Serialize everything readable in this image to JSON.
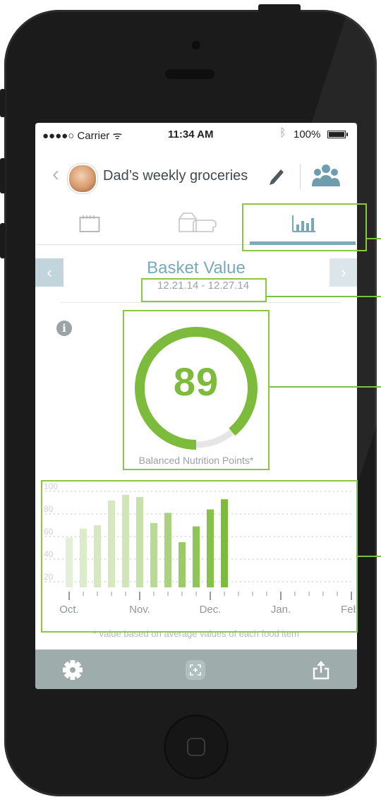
{
  "status_bar": {
    "carrier": "●●●●○ Carrier ᯤ",
    "time": "11:34 AM",
    "battery": "100%"
  },
  "nav": {
    "title": "Dad’s weekly groceries"
  },
  "summary": {
    "title": "Basket Value",
    "date_range": "12.21.14 - 12.27.14",
    "score": "89",
    "score_fraction": 0.89,
    "caption": "Balanced Nutrition Points*"
  },
  "footnote": "* value based on average values of each food item",
  "colors": {
    "accent_green": "#7dbb3c",
    "annotation_green": "#8dc63f",
    "title_blue": "#78a9bb",
    "toolbar": "#9eacac"
  },
  "icons": {
    "settings": "gear-icon",
    "scan": "scan-icon",
    "share": "share-icon",
    "edit": "pencil-icon",
    "group": "group-icon",
    "info": "info-icon"
  },
  "chart_data": {
    "type": "bar",
    "ylim": [
      15,
      105
    ],
    "y_ticks": [
      "100",
      "80",
      "60",
      "40",
      "20"
    ],
    "y_tick_values": [
      100,
      80,
      60,
      40,
      20
    ],
    "x_labels": [
      "Oct.",
      "Nov.",
      "Dec.",
      "Jan.",
      "Feb."
    ],
    "x_label_weeks": [
      0,
      5,
      10,
      15,
      20
    ],
    "values": [
      59,
      67,
      70,
      92,
      97,
      95,
      72,
      81,
      55,
      69,
      84,
      93
    ],
    "colors": [
      "#e4efd7",
      "#dcecca",
      "#d6e8c1",
      "#d5e8c0",
      "#d0e5b8",
      "#c7e1a9",
      "#b9da93",
      "#aad27c",
      "#9bcb67",
      "#8fc555",
      "#86c14a",
      "#7dbb3c"
    ],
    "grid": true
  }
}
